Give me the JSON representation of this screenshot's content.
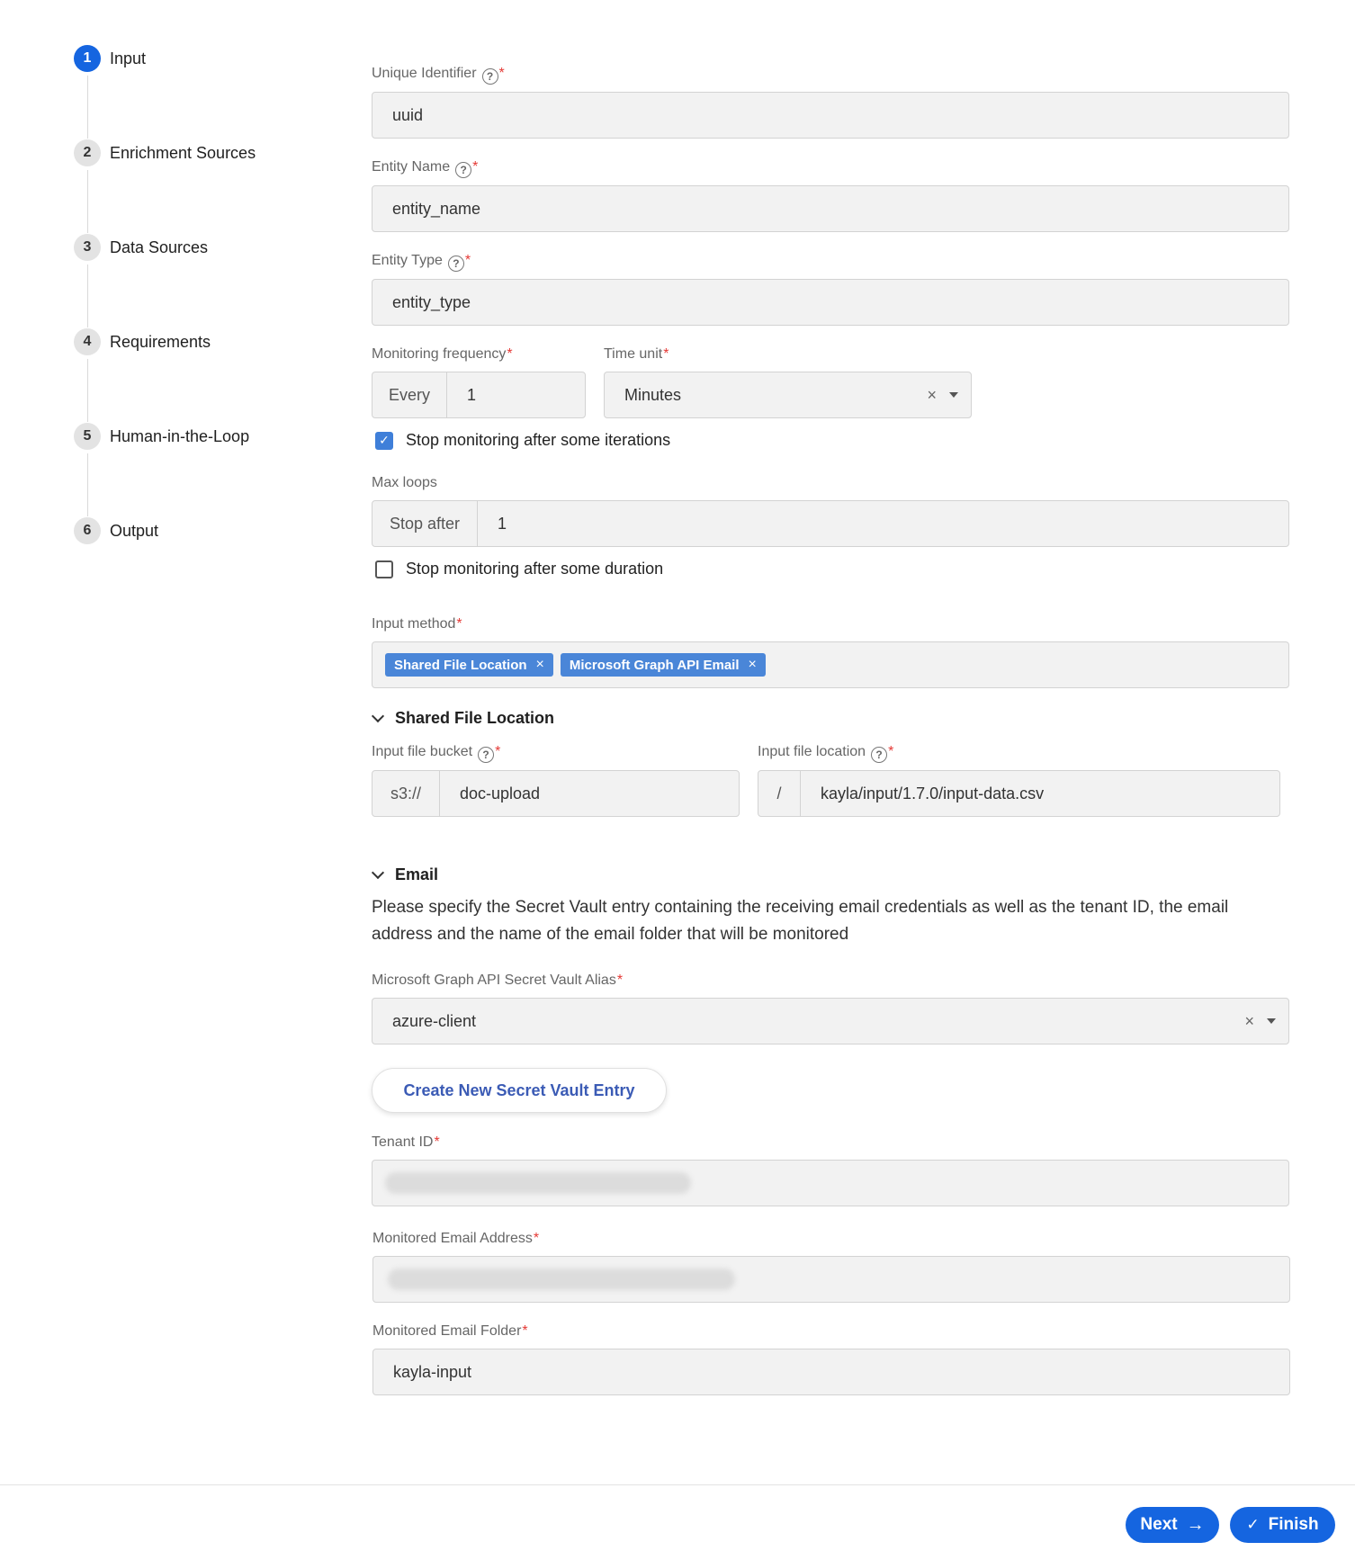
{
  "stepper": [
    {
      "num": "1",
      "label": "Input"
    },
    {
      "num": "2",
      "label": "Enrichment Sources"
    },
    {
      "num": "3",
      "label": "Data Sources"
    },
    {
      "num": "4",
      "label": "Requirements"
    },
    {
      "num": "5",
      "label": "Human-in-the-Loop"
    },
    {
      "num": "6",
      "label": "Output"
    }
  ],
  "form": {
    "unique_identifier": {
      "label": "Unique Identifier",
      "value": "uuid"
    },
    "entity_name": {
      "label": "Entity Name",
      "value": "entity_name"
    },
    "entity_type": {
      "label": "Entity Type",
      "value": "entity_type"
    },
    "monitoring_frequency": {
      "label": "Monitoring frequency",
      "prefix": "Every",
      "value": "1"
    },
    "time_unit": {
      "label": "Time unit",
      "value": "Minutes"
    },
    "stop_iterations": {
      "label": "Stop monitoring after some iterations",
      "checked": true
    },
    "max_loops": {
      "label": "Max loops",
      "prefix": "Stop after",
      "value": "1"
    },
    "stop_duration": {
      "label": "Stop monitoring after some duration",
      "checked": false
    },
    "input_method": {
      "label": "Input method",
      "chips": [
        "Shared File Location",
        "Microsoft Graph API Email"
      ]
    },
    "shared_file": {
      "title": "Shared File Location",
      "bucket": {
        "label": "Input file bucket",
        "prefix": "s3://",
        "value": "doc-upload"
      },
      "location": {
        "label": "Input file location",
        "prefix": "/",
        "value": "kayla/input/1.7.0/input-data.csv"
      }
    },
    "email": {
      "title": "Email",
      "description": "Please specify the Secret Vault entry containing the receiving email credentials as well as the tenant ID, the email address and the name of the email folder that will be monitored",
      "vault_alias": {
        "label": "Microsoft Graph API Secret Vault Alias",
        "value": "azure-client"
      },
      "create_button": "Create New Secret Vault Entry",
      "tenant_id": {
        "label": "Tenant ID"
      },
      "monitored_address": {
        "label": "Monitored Email Address"
      },
      "monitored_folder": {
        "label": "Monitored Email Folder",
        "value": "kayla-input"
      }
    }
  },
  "required_mark": "*",
  "help_glyph": "?",
  "clear_glyph": "×",
  "footer": {
    "next": "Next",
    "next_glyph": "→",
    "finish": "Finish",
    "finish_glyph": "✓"
  },
  "colors": {
    "primary": "#1565e0",
    "chip": "#4a86d8",
    "required": "#e53935"
  }
}
